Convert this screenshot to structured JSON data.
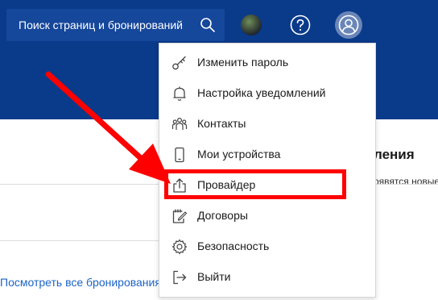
{
  "header": {
    "search_placeholder": "Поиск страниц и бронирований"
  },
  "background": {
    "heading_partial": "ления",
    "subtext_partial": "оявятся новые",
    "view_all_link": "Посмотреть все бронирования"
  },
  "menu": {
    "items": [
      {
        "label": "Изменить пароль",
        "icon": "key-icon"
      },
      {
        "label": "Настройка уведомлений",
        "icon": "bell-icon"
      },
      {
        "label": "Контакты",
        "icon": "contacts-icon"
      },
      {
        "label": "Мои устройства",
        "icon": "phone-icon"
      },
      {
        "label": "Провайдер",
        "icon": "share-icon"
      },
      {
        "label": "Договоры",
        "icon": "contract-icon"
      },
      {
        "label": "Безопасность",
        "icon": "gear-icon"
      },
      {
        "label": "Выйти",
        "icon": "logout-icon"
      }
    ],
    "highlighted": "Провайдер"
  },
  "annotation": {
    "color": "#ff0000"
  },
  "colors": {
    "header_bg": "#0a3a8a",
    "search_bg": "#15479b",
    "link": "#1d64c4"
  }
}
